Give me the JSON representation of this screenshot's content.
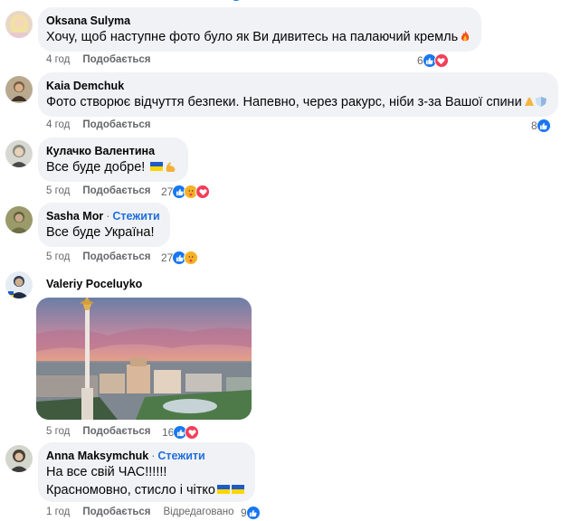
{
  "comments": [
    {
      "author": "Oksana Sulyma",
      "text": "Хочу, щоб наступне фото було як Ви дивитесь на палаючий кремль",
      "time": "4 год",
      "like": "Подобається",
      "reactions_count": "6",
      "reaction_icons": [
        "like-icon",
        "love-icon"
      ],
      "text_emoji": "fire-icon"
    },
    {
      "author": "Kaia Demchuk",
      "text": "Фото створює відчуття безпеки. Напевно, через ракурс, ніби з-за Вашої спини",
      "time": "4 год",
      "like": "Подобається",
      "reactions_count": "8",
      "reaction_icons": [
        "like-icon"
      ],
      "text_emoji": "pray-shield-icon"
    },
    {
      "author": "Кулачко Валентина",
      "text": "Все буде добре! ",
      "time": "5 год",
      "like": "Подобається",
      "reactions_count": "27",
      "reaction_icons": [
        "like-icon",
        "care-icon",
        "love-icon"
      ],
      "text_emoji": "ukraine-flag-muscle-icon"
    },
    {
      "author": "Sasha Mor",
      "follow": "Стежити",
      "text": "Все буде Україна!",
      "time": "5 год",
      "like": "Подобається",
      "reactions_count": "27",
      "reaction_icons": [
        "like-icon",
        "care-icon"
      ]
    },
    {
      "author": "Valeriy Poceluyko",
      "time": "5 год",
      "like": "Подобається",
      "reactions_count": "16",
      "reaction_icons": [
        "like-icon",
        "love-icon"
      ],
      "image": "kyiv-independence-square-photo"
    },
    {
      "author": "Anna Maksymchuk",
      "follow": "Стежити",
      "text_line1": "На все свій ЧАС!!!!!!",
      "text_line2": "Красномовно, стисло і чітко",
      "time": "1 год",
      "like": "Подобається",
      "edited": "Відредаговано",
      "reactions_count": "9",
      "reaction_icons": [
        "like-icon"
      ],
      "text_emoji": "ukraine-flags-icon"
    }
  ],
  "colors": {
    "bubble": "#f0f2f5",
    "meta": "#65676b",
    "link": "#216fdb",
    "like": "#1877f2",
    "love": "#f33e58",
    "care": "#f7b125"
  }
}
